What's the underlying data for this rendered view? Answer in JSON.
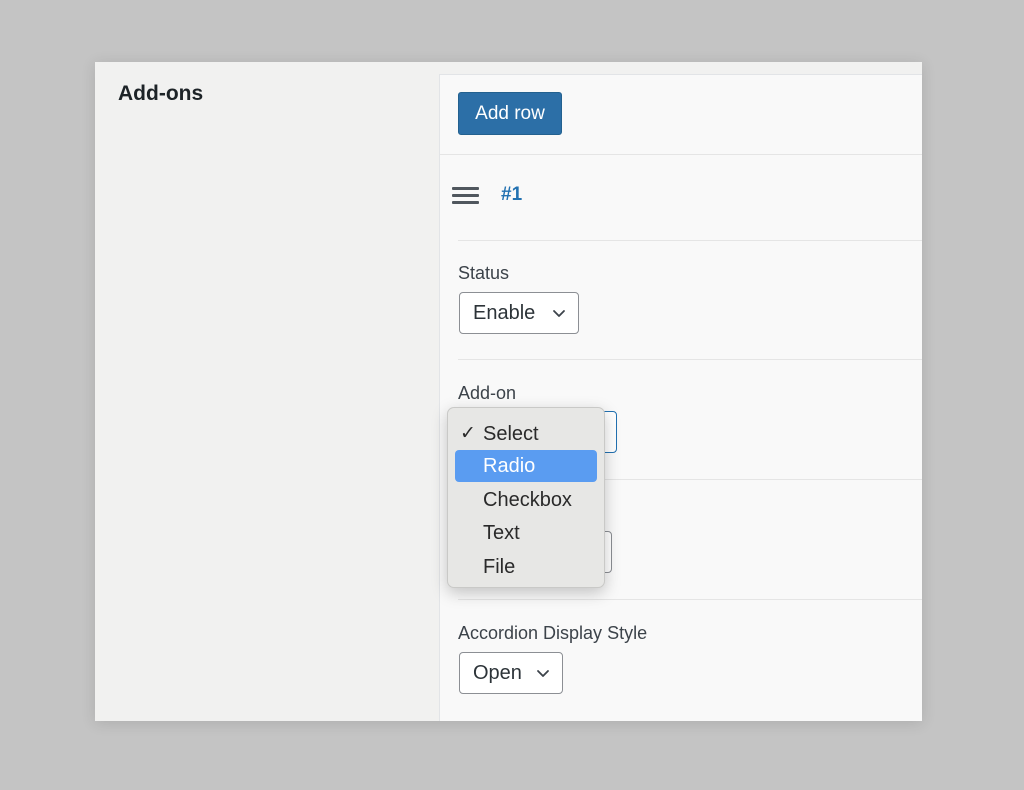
{
  "sidebar": {
    "title": "Add-ons"
  },
  "toolbar": {
    "add_row_label": "Add row"
  },
  "row": {
    "number": "#1"
  },
  "fields": {
    "status": {
      "label": "Status",
      "value": "Enable"
    },
    "addon": {
      "label": "Add-on"
    },
    "accordion": {
      "label": "Accordion Display Style",
      "value": "Open"
    }
  },
  "dropdown": {
    "check_glyph": "✓",
    "options": [
      {
        "label": "Select",
        "selected": true
      },
      {
        "label": "Radio",
        "highlighted": true
      },
      {
        "label": "Checkbox"
      },
      {
        "label": "Text"
      },
      {
        "label": "File"
      }
    ]
  },
  "colors": {
    "primary_button": "#2c6fa7",
    "row_number": "#2271b1",
    "highlight": "#5a9cf1"
  }
}
